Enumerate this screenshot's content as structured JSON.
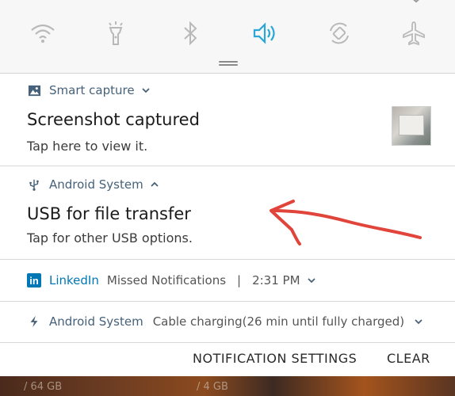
{
  "quick_settings": {
    "tiles": [
      {
        "icon": "wifi-icon",
        "active": false
      },
      {
        "icon": "flashlight-icon",
        "active": false
      },
      {
        "icon": "bluetooth-icon",
        "active": false
      },
      {
        "icon": "sound-icon",
        "active": true
      },
      {
        "icon": "auto-rotate-icon",
        "active": false
      },
      {
        "icon": "airplane-mode-icon",
        "active": false
      }
    ],
    "active_color": "#2aa7d6",
    "inactive_color": "#b9b9b9"
  },
  "notifications": {
    "smart_capture": {
      "app": "Smart capture",
      "title": "Screenshot captured",
      "text": "Tap here to view it."
    },
    "usb": {
      "app": "Android System",
      "title": "USB for file transfer",
      "text": "Tap for other USB options."
    },
    "linkedin": {
      "app": "LinkedIn",
      "summary": "Missed Notifications",
      "separator": "|",
      "time": "2:31 PM",
      "brand_color": "#0077b5"
    },
    "charging": {
      "app": "Android System",
      "text": "Cable charging(26 min until fully charged)"
    }
  },
  "footer": {
    "settings_label": "NOTIFICATION SETTINGS",
    "clear_label": "CLEAR"
  },
  "background": {
    "storage_left": "/ 64 GB",
    "storage_right": "/ 4 GB"
  },
  "annotation_color": "#e0443a"
}
